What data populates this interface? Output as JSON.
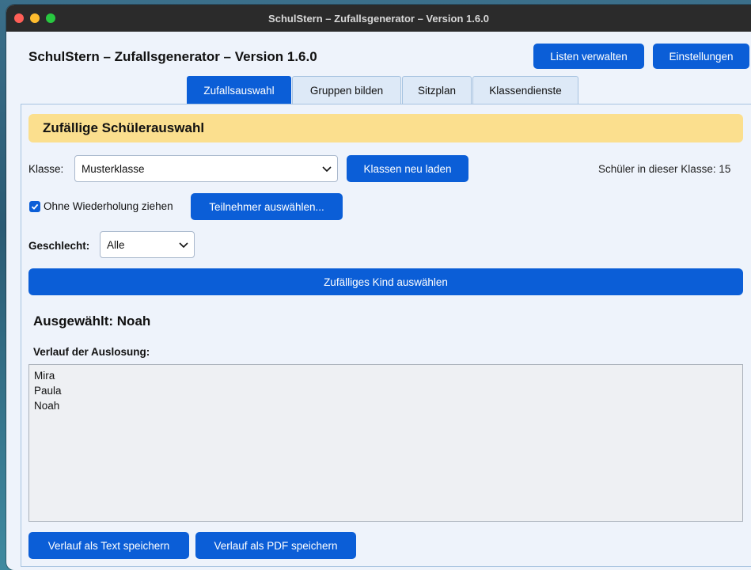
{
  "window": {
    "title": "SchulStern – Zufallsgenerator – Version 1.6.0"
  },
  "header": {
    "app_title": "SchulStern – Zufallsgenerator – Version 1.6.0",
    "manage_lists_label": "Listen verwalten",
    "settings_label": "Einstellungen"
  },
  "tabs": [
    {
      "label": "Zufallsauswahl",
      "active": true
    },
    {
      "label": "Gruppen bilden",
      "active": false
    },
    {
      "label": "Sitzplan",
      "active": false
    },
    {
      "label": "Klassendienste",
      "active": false
    }
  ],
  "main": {
    "section_title": "Zufällige Schülerauswahl",
    "class_label": "Klasse:",
    "class_value": "Musterklasse",
    "reload_classes_label": "Klassen neu laden",
    "student_count_text": "Schüler in dieser Klasse: 15",
    "no_repeat_label": "Ohne Wiederholung ziehen",
    "no_repeat_checked": true,
    "select_participants_label": "Teilnehmer auswählen...",
    "gender_label": "Geschlecht:",
    "gender_value": "Alle",
    "pick_random_label": "Zufälliges Kind auswählen",
    "selected_text": "Ausgewählt: Noah",
    "history_label": "Verlauf der Auslosung:",
    "history": [
      "Mira",
      "Paula",
      "Noah"
    ],
    "save_text_label": "Verlauf als Text speichern",
    "save_pdf_label": "Verlauf als PDF speichern"
  },
  "colors": {
    "accent": "#0b5ed7",
    "banner": "#fbdf8e",
    "background": "#eef3fb"
  }
}
